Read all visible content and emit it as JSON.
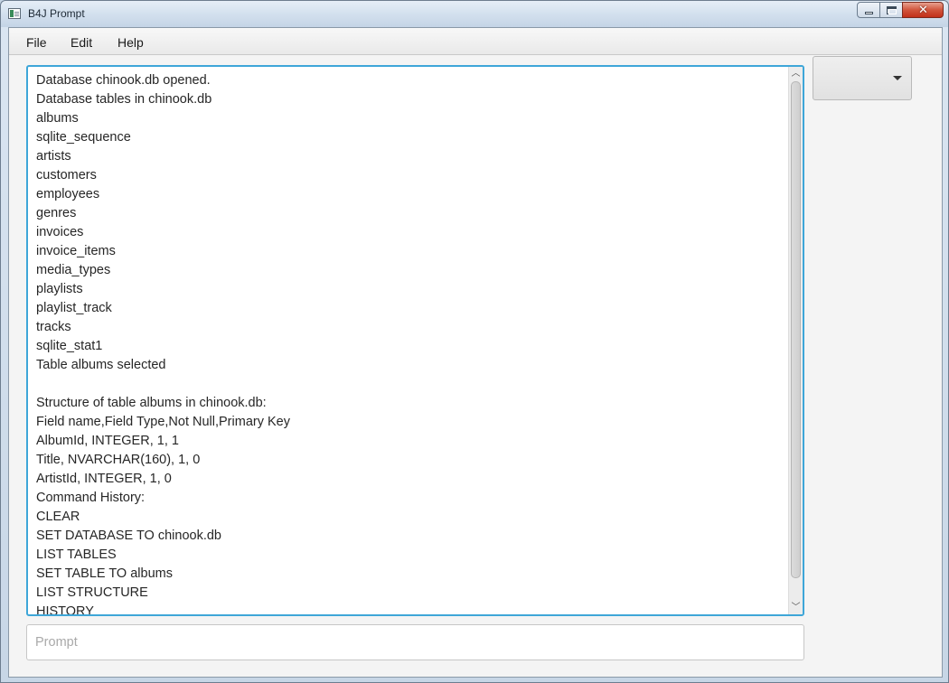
{
  "window": {
    "title": "B4J Prompt"
  },
  "menu": [
    {
      "label": "File"
    },
    {
      "label": "Edit"
    },
    {
      "label": "Help"
    }
  ],
  "log": {
    "lines": [
      "Database chinook.db opened.",
      "Database tables in chinook.db",
      "albums",
      "sqlite_sequence",
      "artists",
      "customers",
      "employees",
      "genres",
      "invoices",
      "invoice_items",
      "media_types",
      "playlists",
      "playlist_track",
      "tracks",
      "sqlite_stat1",
      "Table albums selected",
      "",
      "Structure of table albums in chinook.db:",
      "Field name,Field Type,Not Null,Primary Key",
      "AlbumId, INTEGER, 1, 1",
      "Title, NVARCHAR(160), 1, 0",
      "ArtistId, INTEGER, 1, 0",
      "Command History:",
      "CLEAR",
      "SET DATABASE TO chinook.db",
      "LIST TABLES",
      "SET TABLE TO albums",
      "LIST STRUCTURE",
      "HISTORY"
    ]
  },
  "combo": {
    "value": ""
  },
  "prompt": {
    "value": "",
    "placeholder": "Prompt"
  },
  "icons": {
    "app": "app-icon",
    "combo_arrow": "chevron-down-icon",
    "scroll_up": "chevron-up-icon",
    "scroll_down": "chevron-down-icon"
  },
  "colors": {
    "focus_border": "#3ea6d8",
    "close_button": "#c2301a"
  }
}
